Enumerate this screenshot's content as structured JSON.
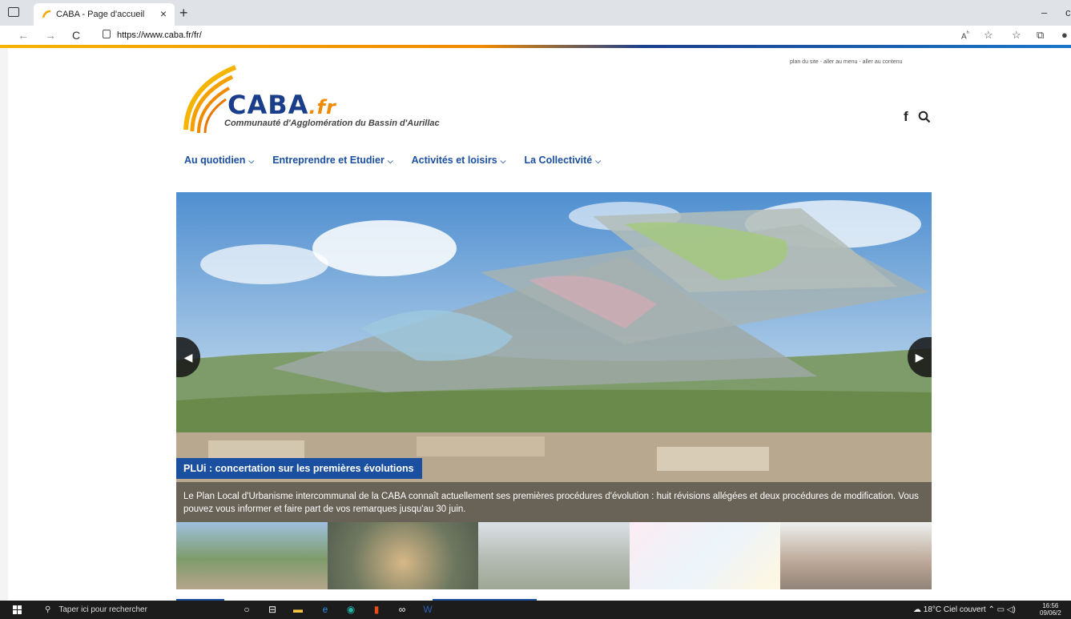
{
  "browser": {
    "tab_title": "CABA - Page d'accueil",
    "tab_close": "×",
    "new_tab": "+",
    "url": "https://www.caba.fr/fr/",
    "minimize": "–"
  },
  "site": {
    "utility_links": "plan du site  -  aller au menu  -  aller au contenu",
    "logo_name": "CABA",
    "logo_tld": ".fr",
    "logo_subtitle": "Communauté d'Agglomération du Bassin d'Aurillac",
    "facebook": "f",
    "nav": [
      {
        "label": "Au quotidien"
      },
      {
        "label": "Entreprendre et Etudier"
      },
      {
        "label": "Activités et loisirs"
      },
      {
        "label": "La Collectivité"
      }
    ],
    "slide": {
      "title": "PLUi : concertation sur les premières évolutions",
      "text": "Le Plan Local d'Urbanisme intercommunal de la CABA connaît actuellement ses premières procédures d'évolution : huit révisions allégées et deux procédures de modification. Vous pouvez vous informer et faire part de vos remarques jusqu'au 30 juin."
    }
  },
  "taskbar": {
    "search_placeholder": "Taper ici pour rechercher",
    "weather": "18°C  Ciel couvert",
    "time": "16:56",
    "date": "09/06/2"
  },
  "colors": {
    "brand_blue": "#1b4fa0",
    "brand_orange": "#f08a00"
  }
}
